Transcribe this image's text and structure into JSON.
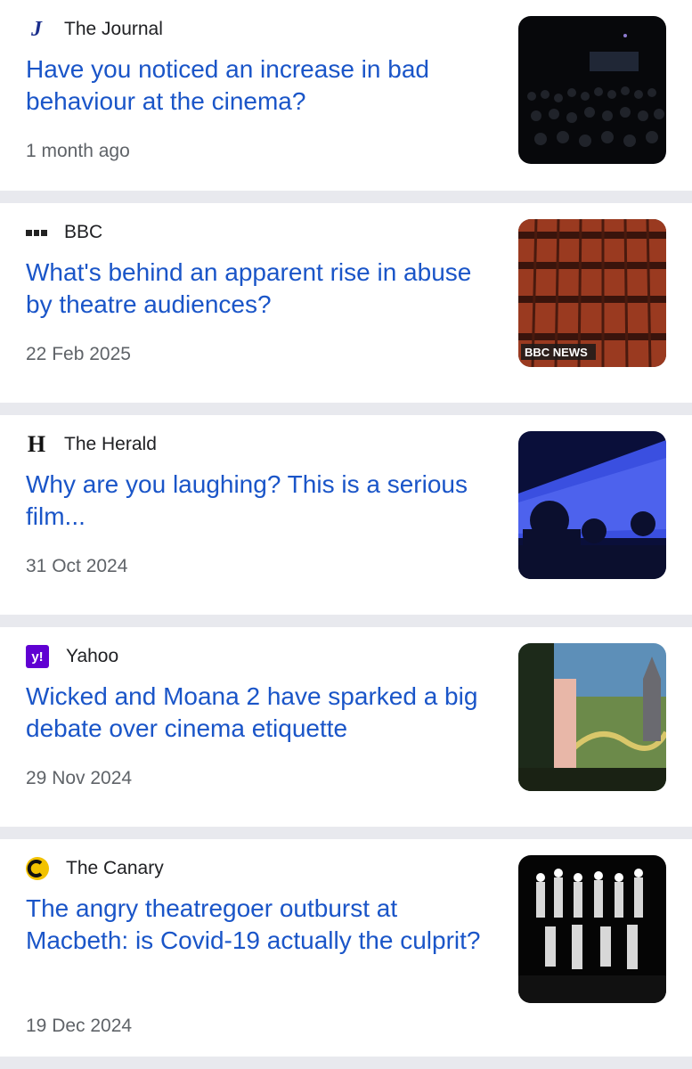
{
  "articles": [
    {
      "source": "The Journal",
      "source_icon": "journal-logo-icon",
      "headline": "Have you noticed an increase in bad behaviour at the cinema?",
      "date": "1 month ago"
    },
    {
      "source": "BBC",
      "source_icon": "bbc-logo-icon",
      "headline": "What's behind an apparent rise in abuse by theatre audiences?",
      "date": "22 Feb 2025",
      "thumb_caption": "BBC NEWS"
    },
    {
      "source": "The Herald",
      "source_icon": "herald-logo-icon",
      "headline": "Why are you laughing? This is a serious film...",
      "date": "31 Oct 2024"
    },
    {
      "source": "Yahoo",
      "source_icon": "yahoo-logo-icon",
      "headline": "Wicked and Moana 2 have sparked a big debate over cinema etiquette",
      "date": "29 Nov 2024"
    },
    {
      "source": "The Canary",
      "source_icon": "canary-logo-icon",
      "headline": "The angry theatregoer outburst at Macbeth: is Covid-19 actually the culprit?",
      "date": "19 Dec 2024"
    }
  ],
  "colors": {
    "headline": "#1a55c8",
    "separator": "#e8e9ee",
    "meta": "#5f6368"
  }
}
